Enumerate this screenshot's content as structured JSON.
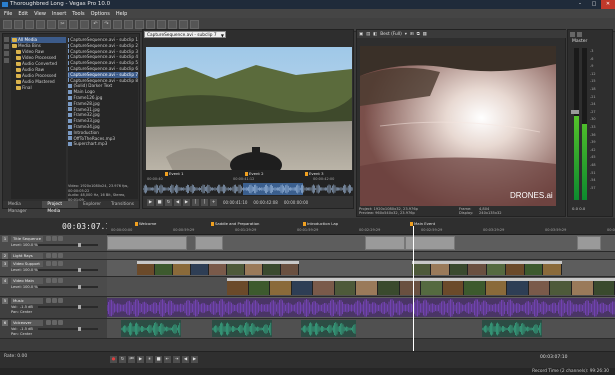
{
  "window": {
    "title": "Thoroughbred Long - Vegas Pro 10.0"
  },
  "menu": [
    "File",
    "Edit",
    "View",
    "Insert",
    "Tools",
    "Options",
    "Help"
  ],
  "explorer": {
    "tree": [
      "All Media",
      "Media Bins",
      "Video Raw",
      "Video Processed",
      "Audio Converted",
      "Audio Raw",
      "Audio Processed",
      "Audio Mastered",
      "Final"
    ],
    "files": [
      "CaptureSequence.avi - subclip 1",
      "CaptureSequence.avi - subclip 2",
      "CaptureSequence.avi - subclip 3",
      "CaptureSequence.avi - subclip 4",
      "CaptureSequence.avi - subclip 5",
      "CaptureSequence.avi - subclip 6",
      "CaptureSequence.avi - subclip 7",
      "CaptureSequence.avi - subclip 8",
      "(Solid) Darker Text",
      "Main Logo",
      "Frame126.jpg",
      "Frame28.jpg",
      "Frame31.jpg",
      "Frame32.jpg",
      "Frame33.jpg",
      "Frame34.jpg",
      "Introduction",
      "OffToTheRaces.mp3",
      "Superchart.mp3"
    ],
    "info_lines": [
      "Video: 1920x1080x24, 23.976 fps, 00:00:05:22",
      "Audio: 48,000 Hz, 16 Bit, Stereo, 00:01:09"
    ],
    "tabs": [
      "Media Manager",
      "Project Media",
      "Explorer",
      "Transitions"
    ]
  },
  "trimmer": {
    "source": "CaptureSequence.avi - subclip 7",
    "events": [
      "Event 1",
      "Event 2",
      "Event 3"
    ],
    "ruler": [
      "00:00:40",
      "00:00:41:12",
      "00:00:42:00"
    ],
    "times": [
      "00:00:41:10",
      "00:00:42:08",
      "00:00:00:00"
    ]
  },
  "preview": {
    "mode": "Best (Full)",
    "watermark": "DRONES.ai",
    "info": {
      "project": "Project:  1920x1080x32, 23.976p",
      "preview": "Preview:  960x540x32, 23.976p",
      "frame_label": "Frame:",
      "frame_value": "4,804",
      "display_label": "Display:",
      "display_value": "240x135x32"
    }
  },
  "master": {
    "label": "Master",
    "scale": [
      "-3",
      "-6",
      "-9",
      "-12",
      "-15",
      "-18",
      "-21",
      "-24",
      "-27",
      "-30",
      "-33",
      "-36",
      "-39",
      "-42",
      "-45",
      "-48",
      "-51",
      "-54",
      "-57"
    ],
    "levels": [
      0.55,
      0.5
    ],
    "readout": "0.0  0.0"
  },
  "timeline": {
    "timecode": "00:03:07.10",
    "markers": [
      "Welcome",
      "Saddle and Preparation",
      "Introduction Lap",
      "Main Event"
    ],
    "ruler_ticks": [
      "00:00:00:00",
      "00:00:59:29",
      "00:01:29:29",
      "00:01:59:29",
      "00:02:29:29",
      "00:02:59:29",
      "00:03:29:29",
      "00:03:59:29",
      "00:04:29:29"
    ],
    "tracks": [
      {
        "num": "1",
        "name": "Title Sequence",
        "level": "Level: 100.0 %",
        "kind": "video"
      },
      {
        "num": "2",
        "name": "Light Rays",
        "level": "Level: 100.0 %",
        "kind": "video"
      },
      {
        "num": "3",
        "name": "Video Support",
        "level": "Level: 100.0 %",
        "kind": "video"
      },
      {
        "num": "4",
        "name": "Video Main",
        "level": "Level: 100.0 %",
        "kind": "video"
      },
      {
        "num": "5",
        "name": "Music",
        "vol": "Vol:",
        "vol_value": "-1.5 dB",
        "pan": "Pan:",
        "pan_value": "Center",
        "kind": "audio"
      },
      {
        "num": "6",
        "name": "Voiceover",
        "vol": "Vol:",
        "vol_value": "-1.5 dB",
        "pan": "Pan:",
        "pan_value": "Center",
        "kind": "audio"
      }
    ]
  },
  "bottom": {
    "rate": "Rate: 0.00",
    "end_time": "00:03:07:10",
    "record_time": "Record Time (2 channels): 99:26:30"
  },
  "colors": {
    "video_clip": "#6a6a6a",
    "audio_wave": "#7b46c2",
    "voice_wave": "#38b08a",
    "marker": "#f0a020",
    "title_clip": "#9a9a9a"
  }
}
